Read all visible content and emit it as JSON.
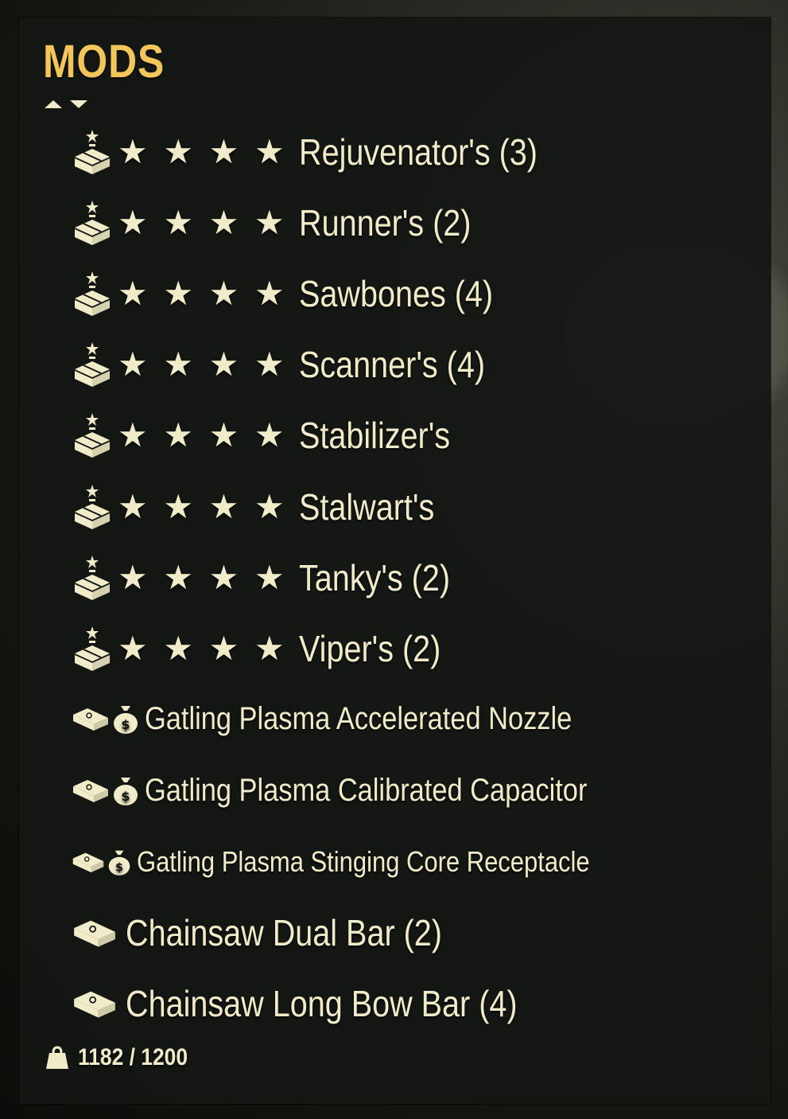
{
  "header": {
    "title": "MODS"
  },
  "sort": {
    "up_icon": "sort-ascending-icon",
    "down_icon": "sort-descending-icon"
  },
  "stars_glyph": "★ ★ ★ ★",
  "legendary_mods": [
    {
      "label": "Rejuvenator's (3)",
      "icon": "legendary-box-icon"
    },
    {
      "label": "Runner's (2)",
      "icon": "legendary-box-icon"
    },
    {
      "label": "Sawbones (4)",
      "icon": "legendary-box-icon"
    },
    {
      "label": "Scanner's (4)",
      "icon": "legendary-box-icon"
    },
    {
      "label": "Stabilizer's",
      "icon": "legendary-box-icon"
    },
    {
      "label": "Stalwart's",
      "icon": "legendary-box-icon"
    },
    {
      "label": "Tanky's (2)",
      "icon": "legendary-box-icon"
    },
    {
      "label": "Viper's (2)",
      "icon": "legendary-box-icon"
    }
  ],
  "plan_mods": [
    {
      "label": "Gatling Plasma Accelerated Nozzle",
      "icons": [
        "mod-bar-icon",
        "money-bag-icon"
      ]
    },
    {
      "label": "Gatling Plasma Calibrated Capacitor",
      "icons": [
        "mod-bar-icon",
        "money-bag-icon"
      ]
    },
    {
      "label": "Gatling Plasma Stinging Core Receptacle",
      "icons": [
        "mod-bar-icon",
        "money-bag-icon"
      ]
    }
  ],
  "part_mods": [
    {
      "label": "Chainsaw Dual Bar (2)",
      "icon": "mod-bar-icon"
    },
    {
      "label": "Chainsaw Long Bow Bar (4)",
      "icon": "mod-bar-icon"
    }
  ],
  "footer": {
    "weight": "1182 / 1200",
    "icon": "weight-icon"
  },
  "colors": {
    "accent": "#f2c65a",
    "text": "#f0ebc8",
    "panel": "#141614"
  }
}
